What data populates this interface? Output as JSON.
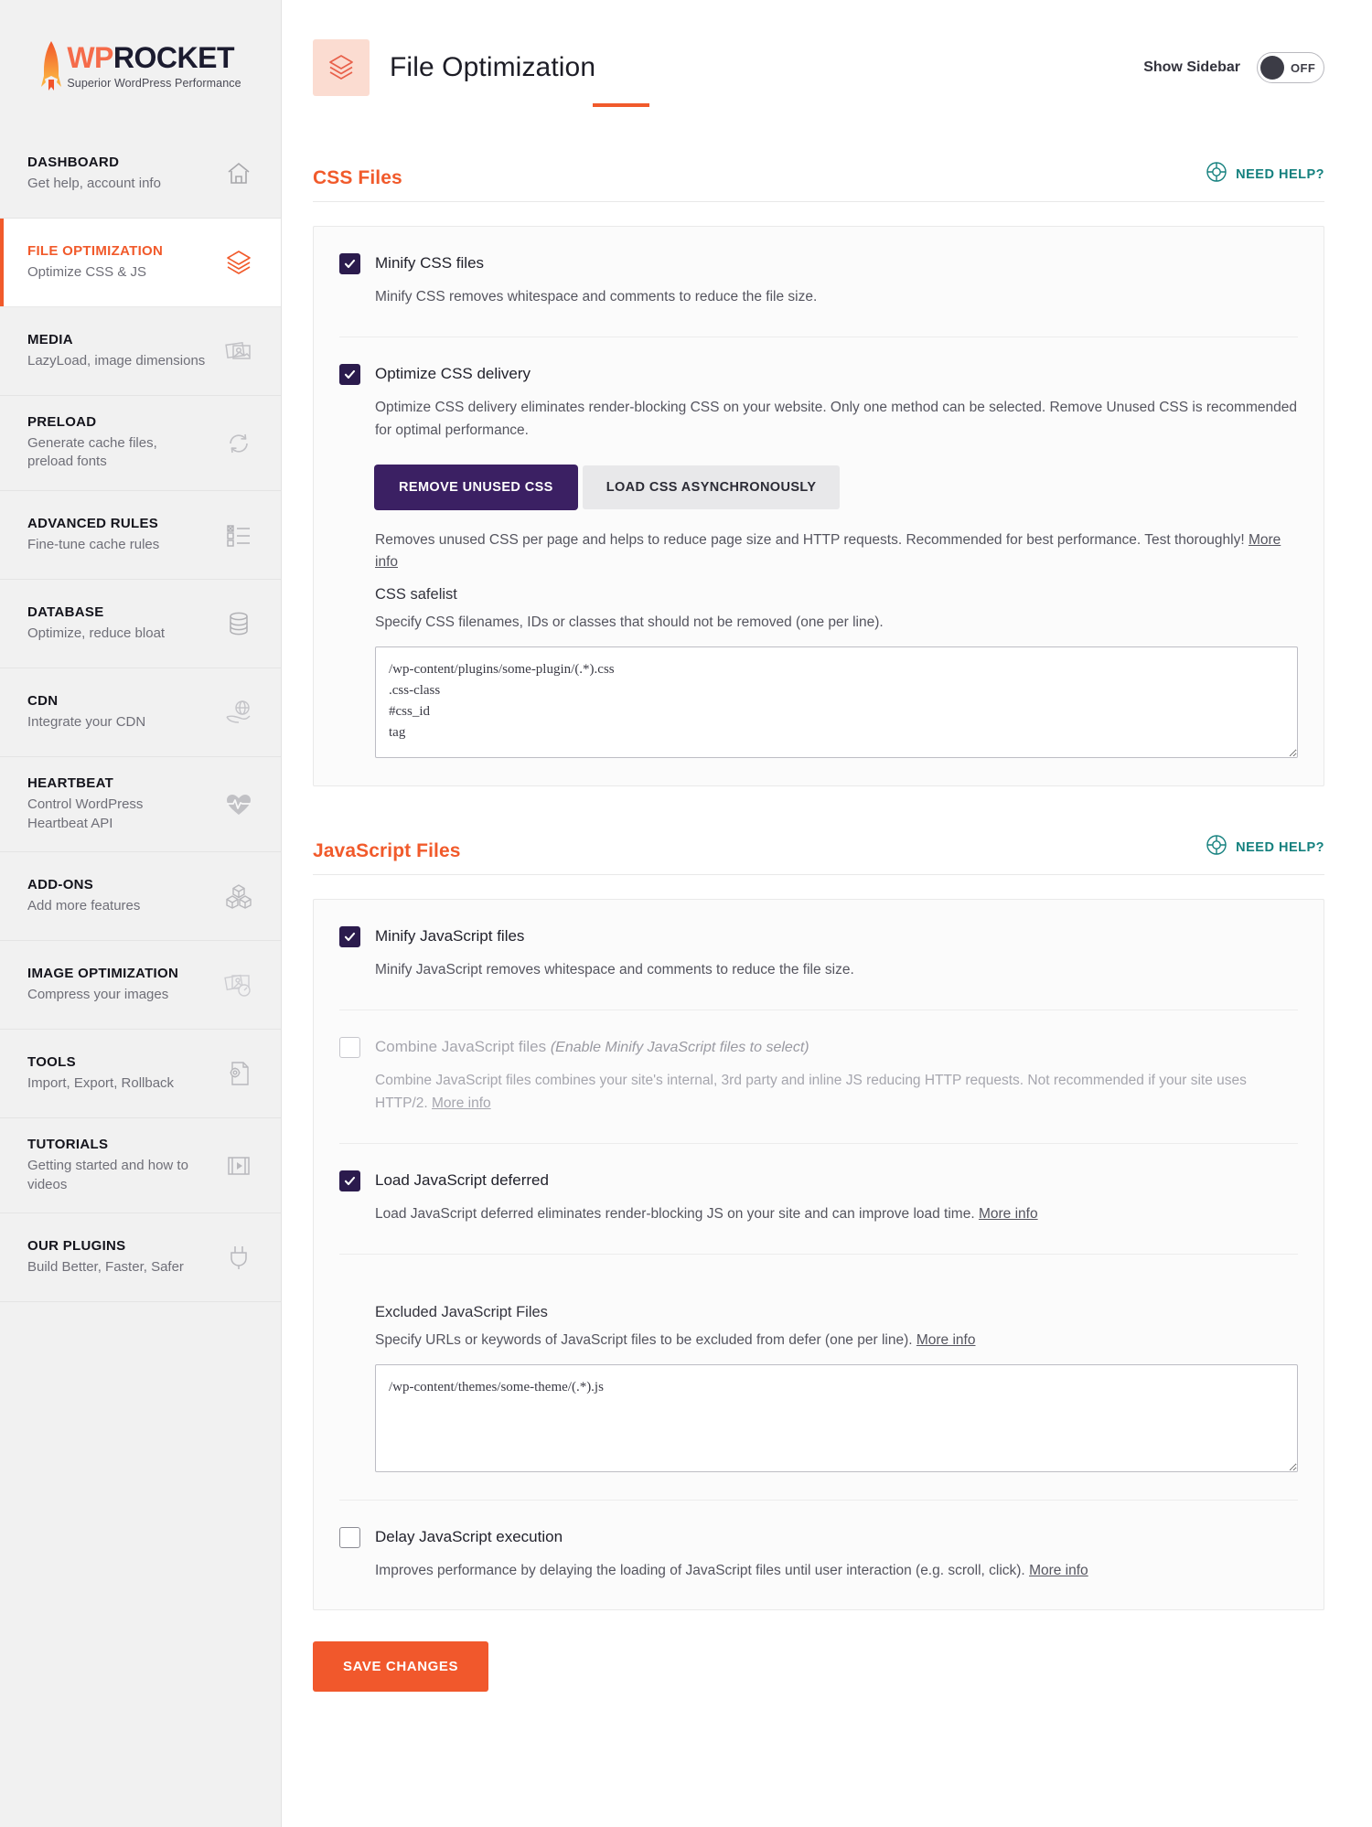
{
  "brand": {
    "name_wp": "WP",
    "name_rocket": "ROCKET",
    "tagline": "Superior WordPress Performance",
    "accent_orange": "#f15a2b",
    "accent_purple": "#3b2063",
    "accent_teal": "#14807e",
    "checkbox_navy": "#2b1b4d"
  },
  "sidebar": {
    "items": [
      {
        "title": "DASHBOARD",
        "sub": "Get help, account info",
        "icon": "home-icon",
        "active": false
      },
      {
        "title": "FILE OPTIMIZATION",
        "sub": "Optimize CSS & JS",
        "icon": "layers-icon",
        "active": true
      },
      {
        "title": "MEDIA",
        "sub": "LazyLoad, image dimensions",
        "icon": "images-icon",
        "active": false
      },
      {
        "title": "PRELOAD",
        "sub": "Generate cache files, preload fonts",
        "icon": "refresh-icon",
        "active": false
      },
      {
        "title": "ADVANCED RULES",
        "sub": "Fine-tune cache rules",
        "icon": "checklist-icon",
        "active": false
      },
      {
        "title": "DATABASE",
        "sub": "Optimize, reduce bloat",
        "icon": "database-icon",
        "active": false
      },
      {
        "title": "CDN",
        "sub": "Integrate your CDN",
        "icon": "globe-hand-icon",
        "active": false
      },
      {
        "title": "HEARTBEAT",
        "sub": "Control WordPress Heartbeat API",
        "icon": "heartbeat-icon",
        "active": false
      },
      {
        "title": "ADD-ONS",
        "sub": "Add more features",
        "icon": "cubes-icon",
        "active": false
      },
      {
        "title": "IMAGE OPTIMIZATION",
        "sub": "Compress your images",
        "icon": "image-speed-icon",
        "active": false
      },
      {
        "title": "TOOLS",
        "sub": "Import, Export, Rollback",
        "icon": "document-gear-icon",
        "active": false
      },
      {
        "title": "TUTORIALS",
        "sub": "Getting started and how to videos",
        "icon": "video-play-icon",
        "active": false
      },
      {
        "title": "OUR PLUGINS",
        "sub": "Build Better, Faster, Safer",
        "icon": "plug-icon",
        "active": false
      }
    ]
  },
  "header": {
    "title": "File Optimization",
    "icon": "layers-icon",
    "show_sidebar_label": "Show Sidebar",
    "toggle_state": "OFF"
  },
  "css_section": {
    "title": "CSS Files",
    "need_help": "NEED HELP?",
    "need_help_icon": "lifebuoy-icon",
    "rows": [
      {
        "label": "Minify CSS files",
        "checked": true,
        "desc": "Minify CSS removes whitespace and comments to reduce the file size."
      },
      {
        "label": "Optimize CSS delivery",
        "checked": true,
        "desc": "Optimize CSS delivery eliminates render-blocking CSS on your website. Only one method can be selected. Remove Unused CSS is recommended for optimal performance."
      }
    ],
    "method_buttons": [
      {
        "label": "REMOVE UNUSED CSS",
        "active": true
      },
      {
        "label": "LOAD CSS ASYNCHRONOUSLY",
        "active": false
      }
    ],
    "method_desc": "Removes unused CSS per page and helps to reduce page size and HTTP requests. Recommended for best performance. Test thoroughly!",
    "method_desc_link": "More info",
    "safelist_title": "CSS safelist",
    "safelist_desc": "Specify CSS filenames, IDs or classes that should not be removed (one per line).",
    "safelist_value": "/wp-content/plugins/some-plugin/(.*).css\n.css-class\n#css_id\ntag"
  },
  "js_section": {
    "title": "JavaScript Files",
    "need_help": "NEED HELP?",
    "need_help_icon": "lifebuoy-icon",
    "minify": {
      "label": "Minify JavaScript files",
      "checked": true,
      "desc": "Minify JavaScript removes whitespace and comments to reduce the file size."
    },
    "combine": {
      "label": "Combine JavaScript files",
      "hint": "(Enable Minify JavaScript files to select)",
      "checked": false,
      "disabled": true,
      "desc": "Combine JavaScript files combines your site's internal, 3rd party and inline JS reducing HTTP requests. Not recommended if your site uses HTTP/2.",
      "desc_link": "More info"
    },
    "defer": {
      "label": "Load JavaScript deferred",
      "checked": true,
      "desc": "Load JavaScript deferred eliminates render-blocking JS on your site and can improve load time.",
      "desc_link": "More info"
    },
    "excluded": {
      "title": "Excluded JavaScript Files",
      "desc": "Specify URLs or keywords of JavaScript files to be excluded from defer (one per line).",
      "desc_link": "More info",
      "value": "/wp-content/themes/some-theme/(.*).js"
    },
    "delay": {
      "label": "Delay JavaScript execution",
      "checked": false,
      "desc": "Improves performance by delaying the loading of JavaScript files until user interaction (e.g. scroll, click).",
      "desc_link": "More info"
    }
  },
  "footer": {
    "save_label": "SAVE CHANGES"
  }
}
